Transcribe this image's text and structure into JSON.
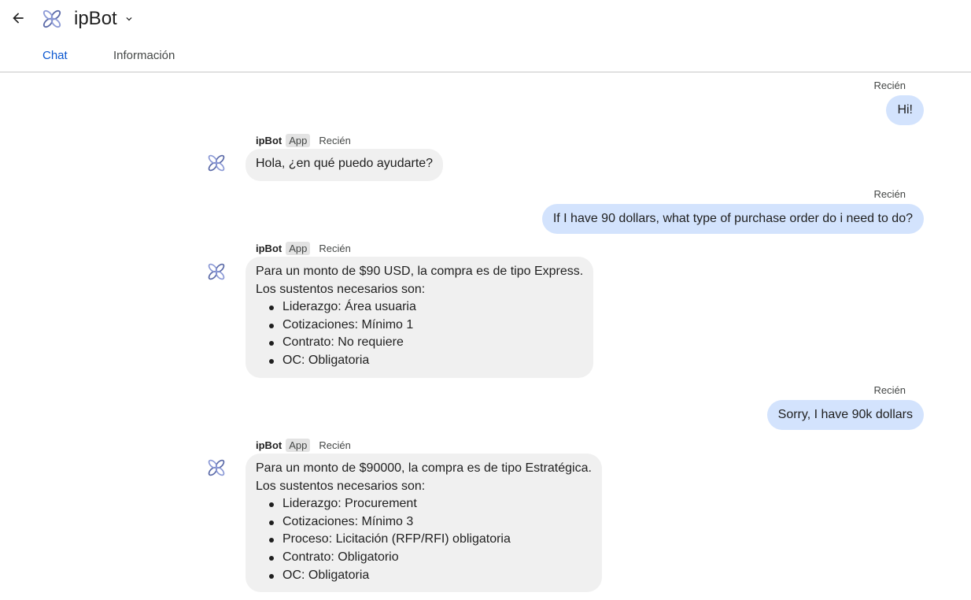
{
  "header": {
    "title": "ipBot",
    "tabs": [
      {
        "label": "Chat",
        "active": true
      },
      {
        "label": "Información",
        "active": false
      }
    ]
  },
  "colors": {
    "accent": "#0b57d0",
    "user_bubble": "#d3e3fd",
    "bot_bubble": "#f0f0f0"
  },
  "icons": [
    "arrow-back-icon",
    "ipbot-logo-icon",
    "chevron-down-icon"
  ],
  "messages": [
    {
      "sender": "user",
      "time": "Recién",
      "text": "Hi!"
    },
    {
      "sender": "bot",
      "name": "ipBot",
      "badge": "App",
      "time": "Recién",
      "lines": [
        "Hola, ¿en qué puedo ayudarte?"
      ],
      "bullets": []
    },
    {
      "sender": "user",
      "time": "Recién",
      "text": "If I have 90 dollars, what type of purchase order do i need to do?"
    },
    {
      "sender": "bot",
      "name": "ipBot",
      "badge": "App",
      "time": "Recién",
      "lines": [
        "Para un monto de $90 USD, la compra es de tipo Express.",
        "Los sustentos necesarios son:"
      ],
      "bullets": [
        "Liderazgo: Área usuaria",
        "Cotizaciones: Mínimo 1",
        "Contrato: No requiere",
        "OC: Obligatoria"
      ]
    },
    {
      "sender": "user",
      "time": "Recién",
      "text": "Sorry, I have 90k dollars"
    },
    {
      "sender": "bot",
      "name": "ipBot",
      "badge": "App",
      "time": "Recién",
      "lines": [
        "Para un monto de $90000, la compra es de tipo Estratégica.",
        "Los sustentos necesarios son:"
      ],
      "bullets": [
        "Liderazgo: Procurement",
        "Cotizaciones: Mínimo 3",
        "Proceso: Licitación (RFP/RFI) obligatoria",
        "Contrato: Obligatorio",
        "OC: Obligatoria"
      ]
    }
  ]
}
